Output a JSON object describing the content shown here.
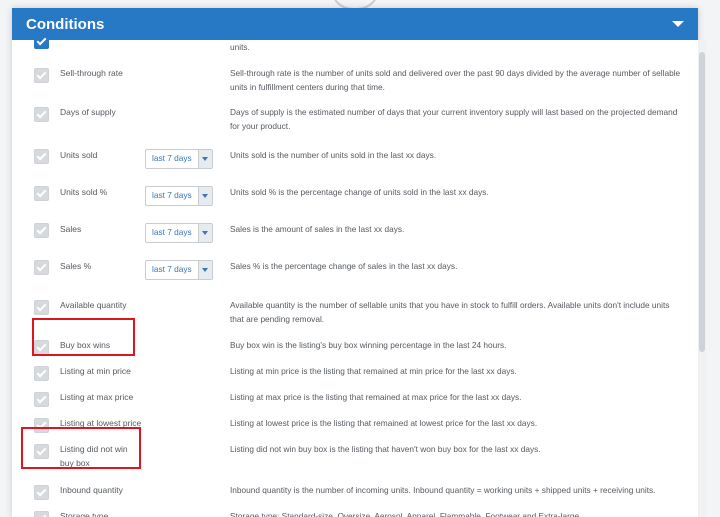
{
  "header": {
    "title": "Conditions"
  },
  "top_partial": {
    "text": "units."
  },
  "rows": [
    {
      "label": "Sell-through rate",
      "desc": "Sell-through rate is the number of units sold and delivered over the past 90 days divided by the average number of sellable units in fulfillment centers during that time."
    },
    {
      "label": "Days of supply",
      "desc": "Days of supply is the estimated number of days that your current inventory supply will last based on the projected demand for your product."
    },
    {
      "label": "Units sold",
      "select": "last 7 days",
      "desc": "Units sold is the number of units sold in the last xx days."
    },
    {
      "label": "Units sold %",
      "select": "last 7 days",
      "desc": "Units sold % is the percentage change of units sold in the last xx days."
    },
    {
      "label": "Sales",
      "select": "last 7 days",
      "desc": "Sales is the amount of sales in the last xx days."
    },
    {
      "label": "Sales %",
      "select": "last 7 days",
      "desc": "Sales % is the percentage change of sales in the last xx days."
    },
    {
      "label": "Available quantity",
      "desc": "Available quantity is the number of sellable units that you have in stock to fulfill orders. Available units don't include units that are pending removal."
    },
    {
      "label": "Buy box wins",
      "desc": "Buy box win is the listing's buy box winning percentage in the last 24 hours."
    },
    {
      "label": "Listing at min price",
      "desc": "Listing at min price is the listing that remained at min price for the last xx days."
    },
    {
      "label": "Listing at max price",
      "desc": "Listing at max price is the listing that remained at max price for the last xx days."
    },
    {
      "label": "Listing at lowest price",
      "desc": "Listing at lowest price is the listing that remained at lowest price for the last xx days."
    },
    {
      "label": "Listing did not win buy box",
      "desc": "Listing did not win buy box is the listing that haven't won buy box for the last xx days."
    },
    {
      "label": "Inbound quantity",
      "desc": "Inbound quantity is the number of incoming units. Inbound quantity = working units + shipped units + receiving units."
    },
    {
      "label": "Storage type",
      "desc": "Storage type: Standard-size, Oversize, Aerosol, Apparel, Flammable, Footwear and Extra-large."
    }
  ],
  "colors": {
    "header": "#2779c6",
    "highlight": "#e0141e"
  }
}
